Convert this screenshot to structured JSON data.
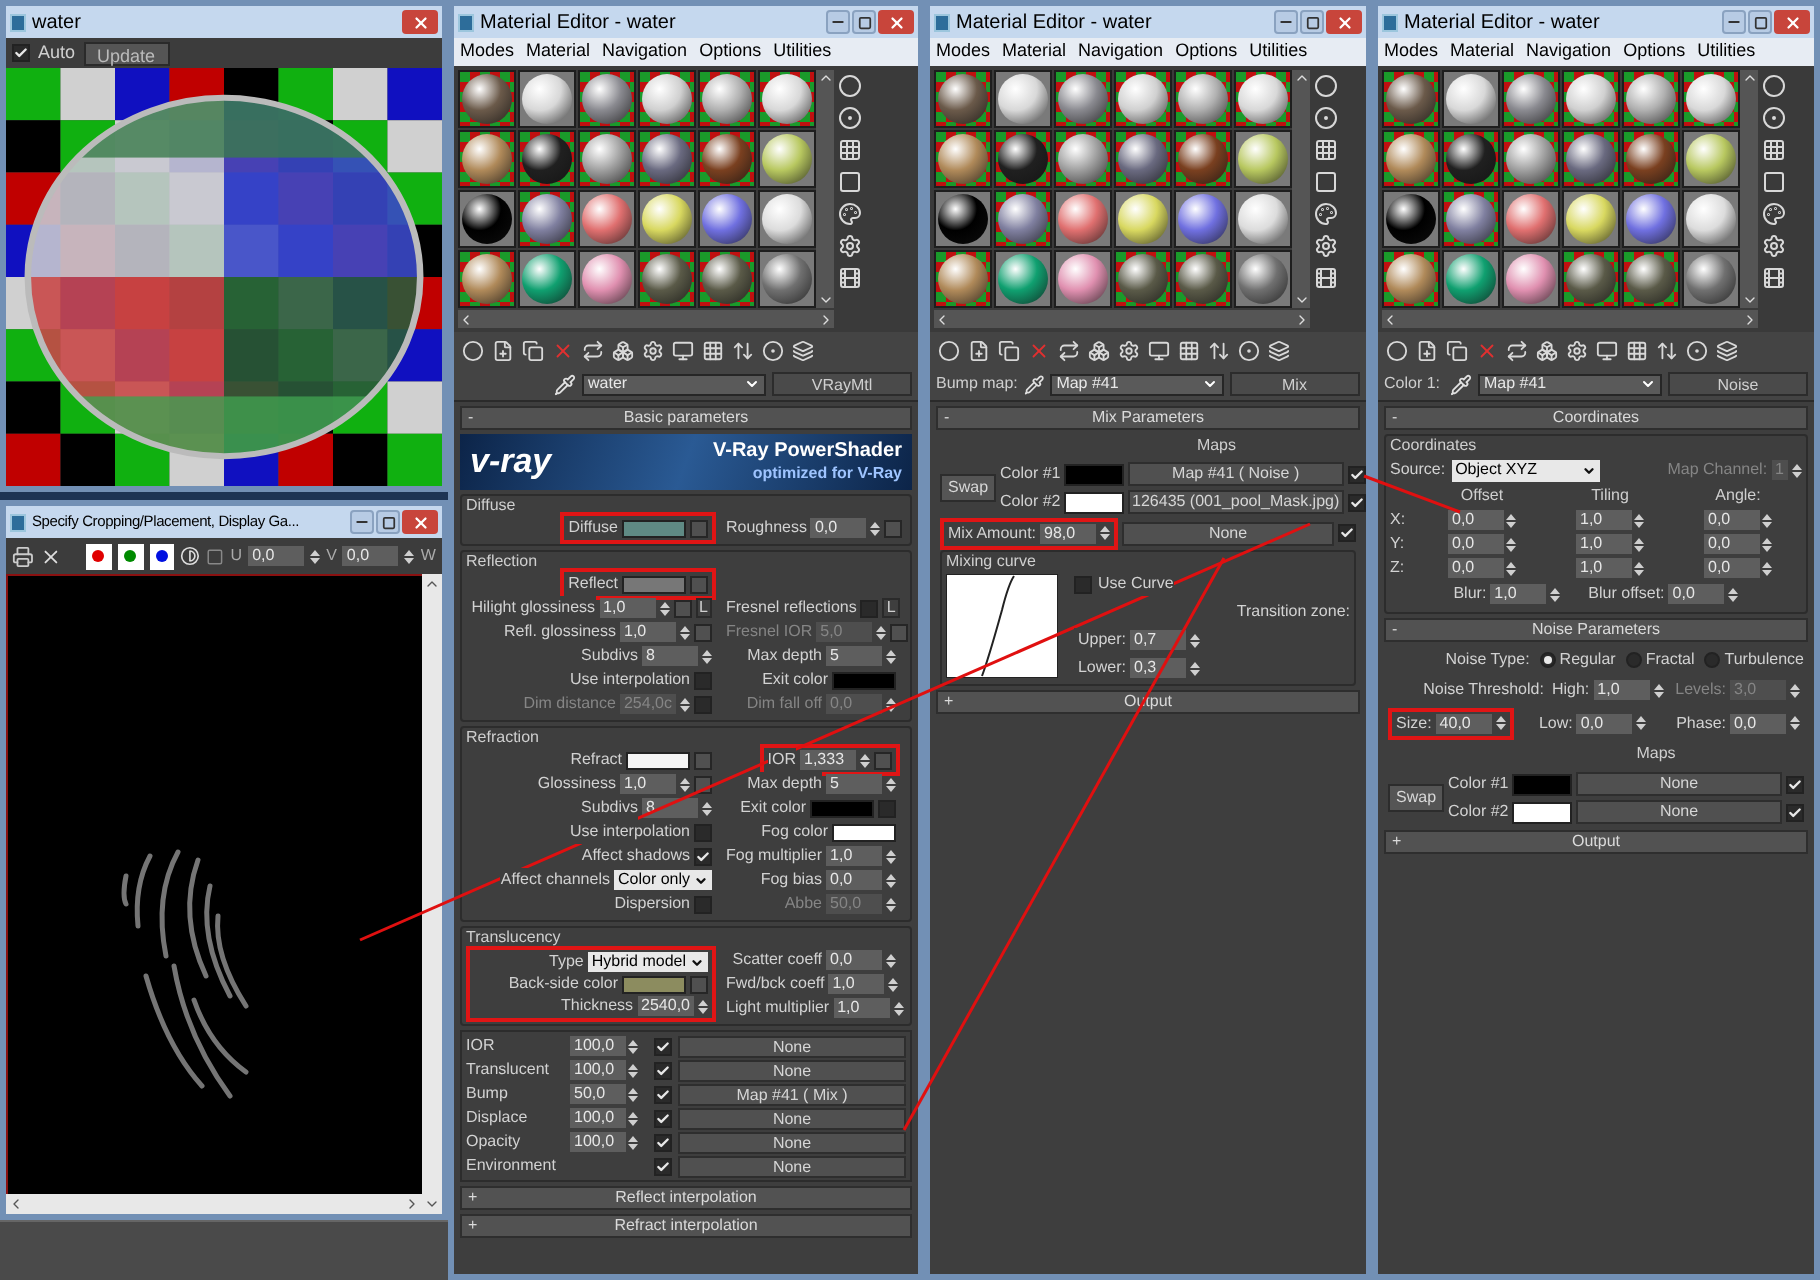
{
  "render_window": {
    "title": "water",
    "auto": {
      "label": "Auto",
      "checked": true
    },
    "update_button": "Update"
  },
  "crop_window": {
    "title": "Specify Cropping/Placement, Display Ga...",
    "channels": [
      {
        "color": "#e00000"
      },
      {
        "color": "#008a00"
      },
      {
        "color": "#0010e0"
      }
    ],
    "u": {
      "label": "U",
      "value": "0,0"
    },
    "v": {
      "label": "V",
      "value": "0,0"
    },
    "w": {
      "label": "W"
    }
  },
  "editors": [
    {
      "kind": "vray",
      "title": "Material Editor - water",
      "menu": [
        "Modes",
        "Material",
        "Navigation",
        "Options",
        "Utilities"
      ],
      "name": "water",
      "type": "VRayMtl",
      "rollout": {
        "sign": "-",
        "title": "Basic parameters"
      },
      "banner": {
        "logo": "v-ray",
        "title": "V-Ray PowerShader",
        "subtitle": "optimized for V-Ray"
      },
      "groups": [
        {
          "title": "Diffuse",
          "rows": [
            [
              {
                "kind": "swatch",
                "label": "Diffuse",
                "color": "#5f8a84",
                "map_slot": true,
                "highlighted": true
              },
              {
                "kind": "spinner",
                "label": "Roughness",
                "value": "0,0",
                "map_slot": true
              }
            ]
          ]
        },
        {
          "title": "Reflection",
          "rows": [
            [
              {
                "kind": "swatch",
                "label": "Reflect",
                "color": "#777777",
                "map_slot": true,
                "highlighted": true
              }
            ],
            [
              {
                "kind": "spinner",
                "label": "Hilight glossiness",
                "value": "1,0",
                "map_slot": true,
                "suffix": "L"
              },
              {
                "kind": "checkbox",
                "label": "Fresnel reflections",
                "checked": false,
                "suffix": "L"
              }
            ],
            [
              {
                "kind": "spinner",
                "label": "Refl. glossiness",
                "value": "1,0",
                "map_slot": true
              },
              {
                "kind": "spinner",
                "label": "Fresnel IOR",
                "value": "5,0",
                "disabled": true,
                "map_slot": true
              }
            ],
            [
              {
                "kind": "spinner",
                "label": "Subdivs",
                "value": "8"
              },
              {
                "kind": "spinner",
                "label": "Max depth",
                "value": "5"
              }
            ],
            [
              {
                "kind": "checkbox",
                "label": "Use interpolation",
                "checked": false
              },
              {
                "kind": "swatch",
                "label": "Exit color",
                "color": "#000000"
              }
            ],
            [
              {
                "kind": "spinner",
                "label": "Dim distance",
                "value": "254,0c",
                "disabled": true,
                "checked": false
              },
              {
                "kind": "spinner",
                "label": "Dim fall off",
                "value": "0,0",
                "disabled": true
              }
            ]
          ]
        },
        {
          "title": "Refraction",
          "rows": [
            [
              {
                "kind": "swatch",
                "label": "Refract",
                "color": "#f4f4f4",
                "map_slot": true
              },
              {
                "kind": "spinner",
                "label": "IOR",
                "value": "1,333",
                "map_slot": true,
                "highlighted": true
              }
            ],
            [
              {
                "kind": "spinner",
                "label": "Glossiness",
                "value": "1,0",
                "map_slot": true
              },
              {
                "kind": "spinner",
                "label": "Max depth",
                "value": "5"
              }
            ],
            [
              {
                "kind": "spinner",
                "label": "Subdivs",
                "value": "8"
              },
              {
                "kind": "swatch",
                "label": "Exit color",
                "color": "#000000",
                "checked": false
              }
            ],
            [
              {
                "kind": "checkbox",
                "label": "Use interpolation",
                "checked": false
              },
              {
                "kind": "swatch",
                "label": "Fog color",
                "color": "#ffffff"
              }
            ],
            [
              {
                "kind": "checkbox",
                "label": "Affect shadows",
                "checked": true
              },
              {
                "kind": "spinner",
                "label": "Fog multiplier",
                "value": "1,0"
              }
            ],
            [
              {
                "kind": "dropdown",
                "label": "Affect channels",
                "value": "Color only"
              },
              {
                "kind": "spinner",
                "label": "Fog bias",
                "value": "0,0"
              }
            ],
            [
              {
                "kind": "checkbox",
                "label": "Dispersion",
                "checked": false
              },
              {
                "kind": "spinner",
                "label": "Abbe",
                "value": "50,0",
                "disabled": true
              }
            ]
          ]
        },
        {
          "title": "Translucency",
          "rows": [
            [
              {
                "kind": "dropdown",
                "label": "Type",
                "value": "Hybrid model",
                "highlighted": true
              },
              {
                "kind": "spinner",
                "label": "Scatter coeff",
                "value": "0,0"
              }
            ],
            [
              {
                "kind": "swatch",
                "label": "Back-side color",
                "color": "#8c8c5f",
                "map_slot": true,
                "highlighted": true
              },
              {
                "kind": "spinner",
                "label": "Fwd/bck coeff",
                "value": "1,0"
              }
            ],
            [
              {
                "kind": "spinner",
                "label": "Thickness",
                "value": "2540,0",
                "highlighted": true
              },
              {
                "kind": "spinner",
                "label": "Light multiplier",
                "value": "1,0"
              }
            ]
          ]
        }
      ],
      "maps": [
        {
          "label": "IOR",
          "amount": "100,0",
          "checked": true,
          "map": "None"
        },
        {
          "label": "Translucent",
          "amount": "100,0",
          "checked": true,
          "map": "None"
        },
        {
          "label": "Bump",
          "amount": "50,0",
          "checked": true,
          "map": "Map #41  ( Mix )"
        },
        {
          "label": "Displace",
          "amount": "100,0",
          "checked": true,
          "map": "None"
        },
        {
          "label": "Opacity",
          "amount": "100,0",
          "checked": true,
          "map": "None"
        },
        {
          "label": "Environment",
          "checked": true,
          "map": "None"
        }
      ],
      "rollouts": [
        {
          "sign": "+",
          "title": "Reflect interpolation"
        },
        {
          "sign": "+",
          "title": "Refract interpolation"
        }
      ]
    },
    {
      "kind": "mix",
      "title": "Material Editor - water",
      "menu": [
        "Modes",
        "Material",
        "Navigation",
        "Options",
        "Utilities"
      ],
      "slot_label": "Bump map:",
      "name": "Map #41",
      "type": "Mix",
      "rollout": {
        "sign": "-",
        "title": "Mix Parameters"
      },
      "maps_heading": "Maps",
      "swap": "Swap",
      "colors": [
        {
          "label": "Color #1",
          "color": "#000000",
          "map": "Map #41  ( Noise )",
          "checked": true
        },
        {
          "label": "Color #2",
          "color": "#ffffff",
          "map": "126435 (001_pool_Mask.jpg)",
          "checked": true
        }
      ],
      "mix_amount": {
        "label": "Mix Amount:",
        "value": "98,0",
        "map": "None",
        "checked": true,
        "highlighted": true
      },
      "curve": {
        "title": "Mixing curve",
        "use_curve": {
          "label": "Use Curve",
          "checked": false
        },
        "transition": "Transition zone:",
        "upper": {
          "label": "Upper:",
          "value": "0,7"
        },
        "lower": {
          "label": "Lower:",
          "value": "0,3"
        }
      },
      "rollouts": [
        {
          "sign": "+",
          "title": "Output"
        }
      ]
    },
    {
      "kind": "noise",
      "title": "Material Editor - water",
      "menu": [
        "Modes",
        "Material",
        "Navigation",
        "Options",
        "Utilities"
      ],
      "slot_label": "Color 1:",
      "name": "Map #41",
      "type": "Noise",
      "coords_rollout": {
        "sign": "-",
        "title": "Coordinates"
      },
      "coords_group": "Coordinates",
      "source": {
        "label": "Source:",
        "value": "Object XYZ"
      },
      "map_channel": {
        "label": "Map Channel:",
        "value": "1",
        "disabled": true
      },
      "headers": [
        "Offset",
        "Tiling",
        "Angle:"
      ],
      "axes": [
        {
          "label": "X:",
          "values": [
            "0,0",
            "1,0",
            "0,0"
          ]
        },
        {
          "label": "Y:",
          "values": [
            "0,0",
            "1,0",
            "0,0"
          ]
        },
        {
          "label": "Z:",
          "values": [
            "0,0",
            "1,0",
            "0,0"
          ]
        }
      ],
      "blur": {
        "label": "Blur:",
        "value": "1,0"
      },
      "blur_offset": {
        "label": "Blur offset:",
        "value": "0,0"
      },
      "noise_rollout": {
        "sign": "-",
        "title": "Noise Parameters"
      },
      "noise_type": {
        "label": "Noise Type:",
        "options": [
          {
            "label": "Regular",
            "selected": true
          },
          {
            "label": "Fractal",
            "selected": false
          },
          {
            "label": "Turbulence",
            "selected": false
          }
        ]
      },
      "threshold_label": "Noise Threshold:",
      "high": {
        "label": "High:",
        "value": "1,0"
      },
      "levels": {
        "label": "Levels:",
        "value": "3,0",
        "disabled": true
      },
      "size": {
        "label": "Size:",
        "value": "40,0",
        "highlighted": true
      },
      "low": {
        "label": "Low:",
        "value": "0,0"
      },
      "phase": {
        "label": "Phase:",
        "value": "0,0"
      },
      "maps_heading": "Maps",
      "swap": "Swap",
      "colors": [
        {
          "label": "Color #1",
          "color": "#000000",
          "map": "None",
          "checked": true
        },
        {
          "label": "Color #2",
          "color": "#ffffff",
          "map": "None",
          "checked": true
        }
      ],
      "rollouts": [
        {
          "sign": "+",
          "title": "Output"
        }
      ]
    }
  ]
}
